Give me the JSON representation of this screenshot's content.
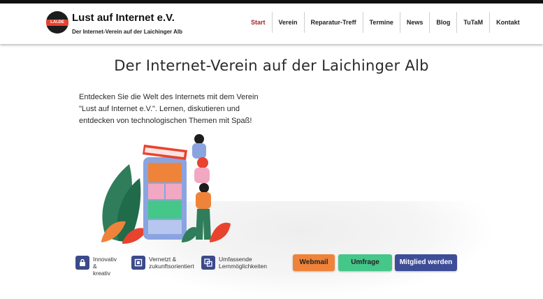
{
  "header": {
    "logo_text": "LAI.DE",
    "brand_name": "Lust auf Internet e.V.",
    "tagline": "Der Internet-Verein auf der Laichinger Alb"
  },
  "nav": {
    "items": [
      {
        "label": "Start",
        "active": true
      },
      {
        "label": "Verein"
      },
      {
        "label": "Reparatur-Treff"
      },
      {
        "label": "Termine"
      },
      {
        "label": "News"
      },
      {
        "label": "Blog"
      },
      {
        "label": "TuTaM"
      },
      {
        "label": "Kontakt"
      }
    ]
  },
  "hero": {
    "title": "Der Internet-Verein auf der Laichinger Alb",
    "text_lines": [
      "Entdecken Sie die Welt des Internets mit dem Verein",
      " \"Lust auf Internet e.V.\". Lernen, diskutieren und",
      "entdecken von technologischen Themen mit Spaß!"
    ]
  },
  "features": [
    {
      "icon": "lock-icon",
      "line1": "Innovativ &",
      "line2": "kreativ"
    },
    {
      "icon": "network-icon",
      "line1": "Vernetzt &",
      "line2": "zukunftsorientiert"
    },
    {
      "icon": "layers-icon",
      "line1": "Umfassende",
      "line2": "Lernmöglichkeiten"
    }
  ],
  "buttons": {
    "webmail": "Webmail",
    "umfrage": "Umfrage",
    "mitglied": "Mitglied werden"
  },
  "colors": {
    "nav_active": "#a3262a",
    "webmail": "#f0833a",
    "umfrage": "#45c78a",
    "mitglied": "#3e4d98",
    "feature_icon": "#3b4a8a"
  }
}
